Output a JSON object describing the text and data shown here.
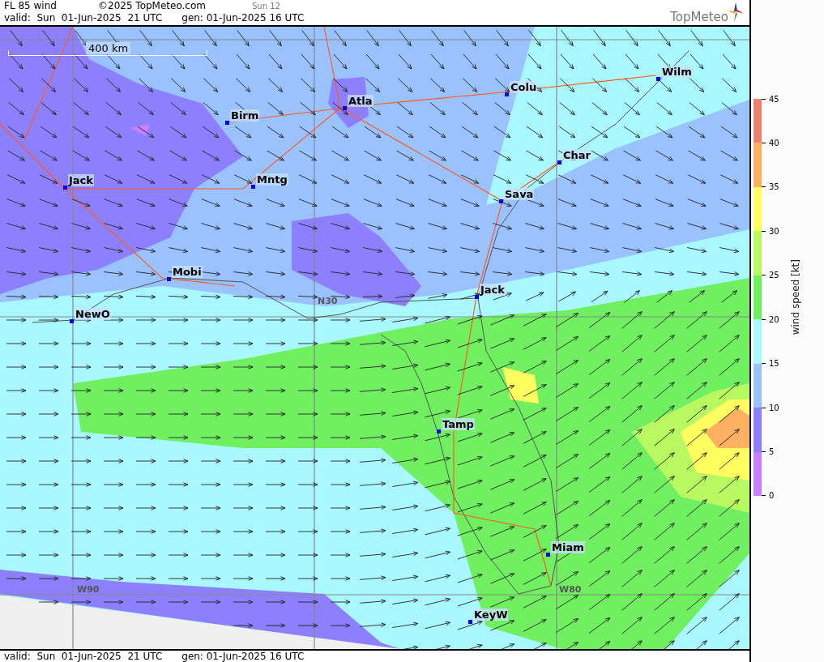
{
  "header": {
    "title": "FL 85 wind",
    "copyright": "©2025 TopMeteo.com",
    "run": "Sun 12",
    "valid": "valid:  Sun  01-Jun-2025  21 UTC",
    "generated": "gen: 01-Jun-2025 16 UTC"
  },
  "logo": {
    "text": "TopMeteo"
  },
  "map": {
    "scale": "400 km",
    "grid_labels": [
      "N30",
      "W90",
      "W80"
    ],
    "cities": [
      "Wilm",
      "Colu",
      "Atla",
      "Birm",
      "Char",
      "Jack",
      "Mntg",
      "Sava",
      "Mobi",
      "Jack",
      "NewO",
      "Tamp",
      "Miam",
      "KeyW"
    ]
  },
  "legend": {
    "title": "wind speed [kt]",
    "ticks": [
      "45",
      "40",
      "35",
      "30",
      "25",
      "20",
      "15",
      "10",
      "5",
      "0"
    ],
    "bands": [
      {
        "color": "#f08070"
      },
      {
        "color": "#ffb060"
      },
      {
        "color": "#ffff60"
      },
      {
        "color": "#b8f860"
      },
      {
        "color": "#70f060"
      },
      {
        "color": "#aaf8ff"
      },
      {
        "color": "#99c2ff"
      },
      {
        "color": "#8c80ff"
      },
      {
        "color": "#c880ff"
      }
    ]
  },
  "footer": {
    "valid": "valid:  Sun  01-Jun-2025  21 UTC",
    "generated": "gen: 01-Jun-2025 16 UTC"
  }
}
